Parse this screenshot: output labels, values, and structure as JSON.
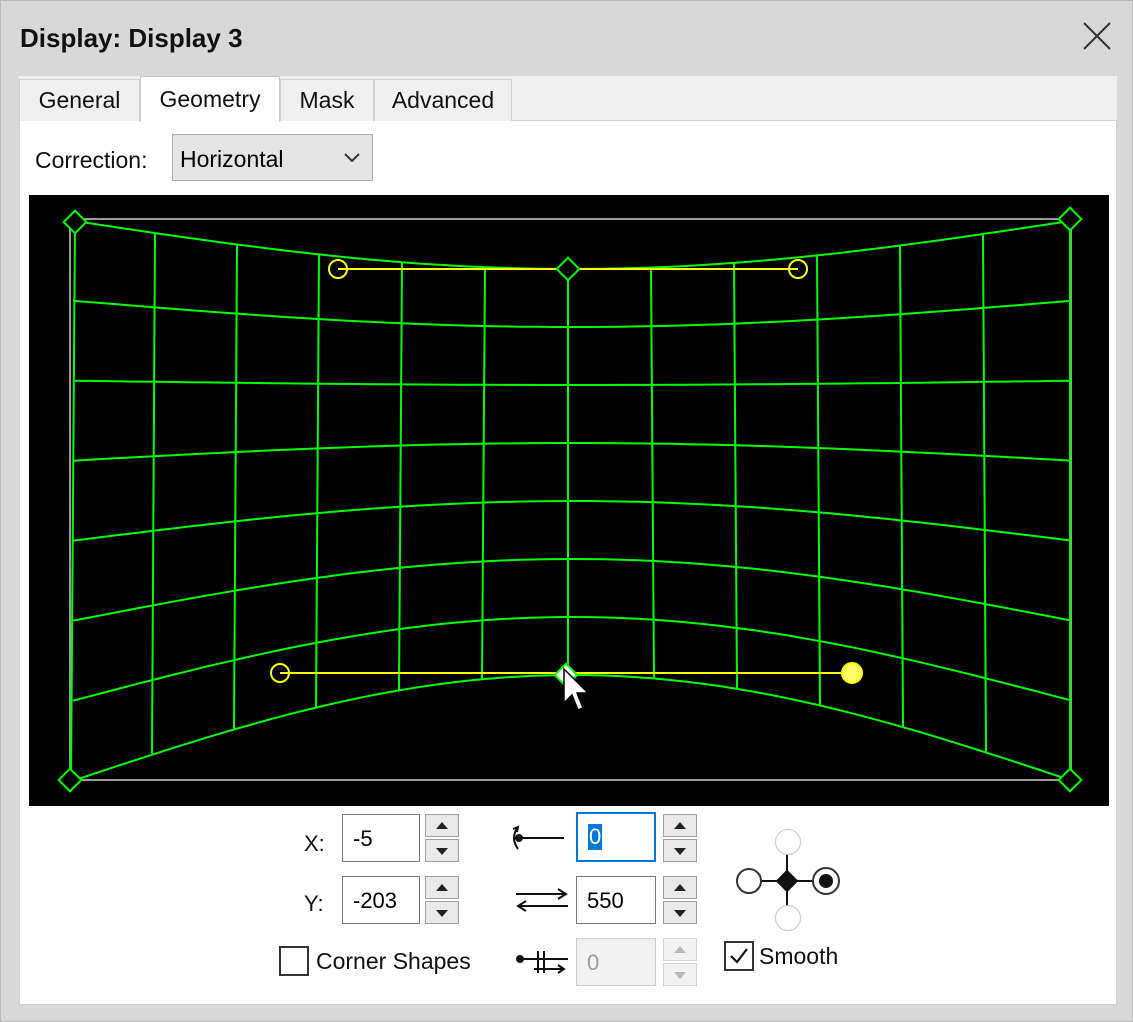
{
  "window": {
    "title": "Display: Display 3",
    "close_icon": "close-icon"
  },
  "tabs": [
    {
      "label": "General",
      "active": false
    },
    {
      "label": "Geometry",
      "active": true
    },
    {
      "label": "Mask",
      "active": false
    },
    {
      "label": "Advanced",
      "active": false
    }
  ],
  "correction": {
    "label": "Correction:",
    "selected": "Horizontal"
  },
  "canvas": {
    "background": "#000000",
    "grid_color": "#00ff00",
    "handle_color": "#ffff00",
    "frame_color": "#9a9a9a"
  },
  "controls": {
    "x_label": "X:",
    "x_value": "-5",
    "y_label": "Y:",
    "y_value": "-203",
    "angle_value": "0",
    "length_value": "550",
    "offset_value": "0",
    "corner_shapes_label": "Corner Shapes",
    "corner_shapes_checked": false,
    "smooth_label": "Smooth",
    "smooth_checked": true
  },
  "icons": {
    "angle": "tangent-angle-icon",
    "length": "tangent-length-icon",
    "offset": "tangent-offset-icon",
    "picker": "handle-selector-icon"
  }
}
